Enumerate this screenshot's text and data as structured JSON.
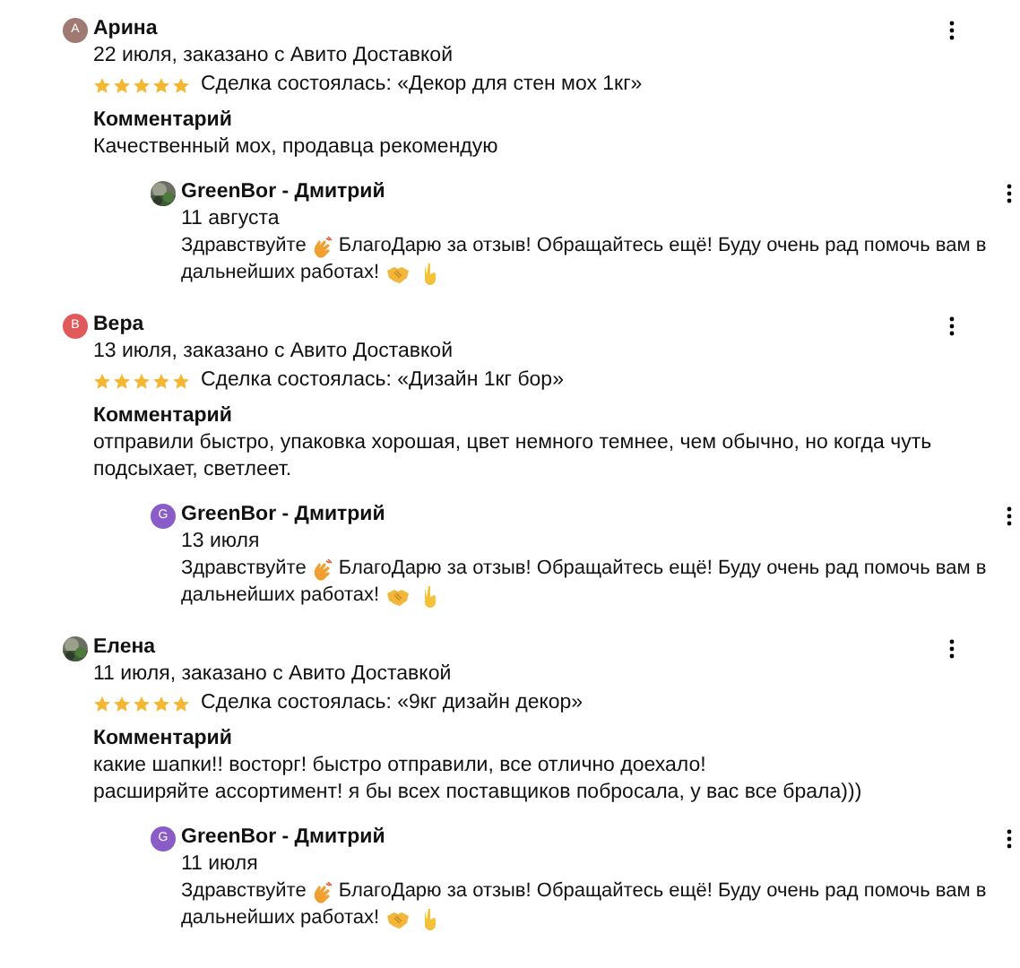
{
  "reviews": [
    {
      "author": "Арина",
      "avatar": {
        "kind": "letter",
        "letter": "А",
        "color": "#a07a72"
      },
      "meta": "22 июля, заказано с Авито Доставкой",
      "stars": 5,
      "deal": "Сделка состоялась: «Декор для стен мох 1кг»",
      "comment_label": "Комментарий",
      "comment": [
        "Качественный мох, продавца рекомендую"
      ],
      "reply": {
        "author": "GreenBor - Дмитрий",
        "avatar": {
          "kind": "picture"
        },
        "date": "11 августа",
        "greeting": "Здравствуйте",
        "text": [
          "БлагоДарю за отзыв! Обращайтесь ещё! Буду очень рад помочь вам в",
          "дальнейших работах!"
        ]
      }
    },
    {
      "author": "Вера",
      "avatar": {
        "kind": "letter",
        "letter": "В",
        "color": "#e05a5a"
      },
      "meta": "13 июля, заказано с Авито Доставкой",
      "stars": 5,
      "deal": "Сделка состоялась: «Дизайн 1кг бор»",
      "comment_label": "Комментарий",
      "comment": [
        "отправили быстро, упаковка хорошая, цвет немного темнее, чем обычно, но когда чуть подсыхает, светлеет."
      ],
      "reply": {
        "author": "GreenBor - Дмитрий",
        "avatar": {
          "kind": "letter",
          "letter": "G",
          "color": "#8a5cc8"
        },
        "date": "13 июля",
        "greeting": "Здравствуйте",
        "text": [
          "БлагоДарю за отзыв! Обращайтесь ещё! Буду очень рад помочь вам в",
          "дальнейших работах!"
        ]
      }
    },
    {
      "author": "Елена",
      "avatar": {
        "kind": "picture"
      },
      "meta": "11 июля, заказано с Авито Доставкой",
      "stars": 5,
      "deal": "Сделка состоялась: «9кг дизайн декор»",
      "comment_label": "Комментарий",
      "comment": [
        "какие шапки!! восторг! быстро отправили, все отлично доехало!",
        "расширяйте ассортимент! я бы всех поставщиков побросала, у вас все брала)))"
      ],
      "reply": {
        "author": "GreenBor - Дмитрий",
        "avatar": {
          "kind": "letter",
          "letter": "G",
          "color": "#8a5cc8"
        },
        "date": "11 июля",
        "greeting": "Здравствуйте",
        "text": [
          "БлагоДарю за отзыв! Обращайтесь ещё! Буду очень рад помочь вам в",
          "дальнейших работах!"
        ]
      }
    }
  ]
}
